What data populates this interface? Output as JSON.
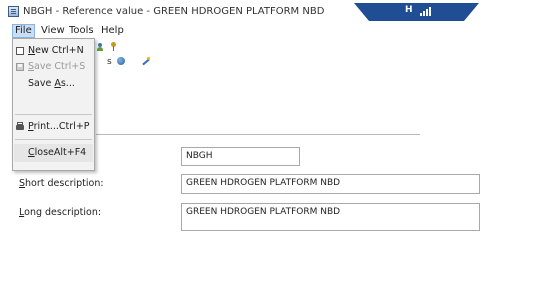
{
  "window": {
    "title": "NBGH - Reference value - GREEN HDROGEN PLATFORM NBD",
    "banner_letter": "H"
  },
  "menubar": {
    "file": "File",
    "view": "View",
    "tools": "Tools",
    "help": "Help"
  },
  "file_menu": {
    "new": {
      "label": "New",
      "underline": "N",
      "rest": "ew",
      "shortcut": "Ctrl+N",
      "enabled": true
    },
    "save": {
      "label": "Save",
      "underline": "S",
      "rest": "ave",
      "shortcut": "Ctrl+S",
      "enabled": false
    },
    "save_as": {
      "label": "Save As...",
      "pre": "Save ",
      "underline": "A",
      "rest": "s...",
      "enabled": true
    },
    "print": {
      "label": "Print...",
      "underline": "P",
      "rest": "rint...",
      "shortcut": "Ctrl+P",
      "enabled": true
    },
    "close": {
      "label": "Close",
      "underline": "C",
      "rest": "lose",
      "shortcut": "Alt+F4",
      "enabled": true
    }
  },
  "toolbar": {
    "partial_text": "s"
  },
  "form": {
    "code_value": "NBGH",
    "short_description": {
      "label_underline": "S",
      "label_rest": "hort description:",
      "value": "GREEN HDROGEN PLATFORM NBD"
    },
    "long_description": {
      "label_underline": "L",
      "label_rest": "ong description:",
      "value": "GREEN HDROGEN PLATFORM NBD"
    }
  },
  "colors": {
    "banner": "#1f4e95",
    "menu_highlight": "#c9def5"
  }
}
